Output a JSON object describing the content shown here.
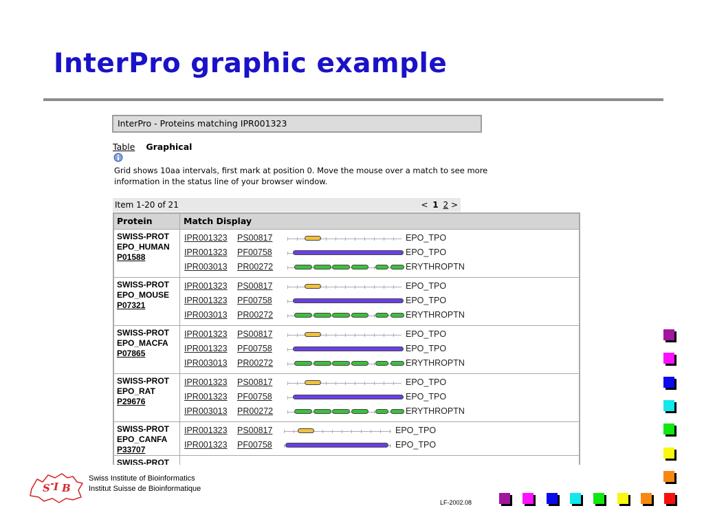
{
  "slide": {
    "title": "InterPro graphic example"
  },
  "page": {
    "header": "InterPro - Proteins matching IPR001323",
    "tabs": {
      "table": "Table",
      "graphical": "Graphical"
    },
    "help_text": "Grid shows 10aa intervals, first mark at position 0. Move the mouse over a match to see more information in the status line of your browser window.",
    "item_count": "Item 1-20 of 21",
    "pager": {
      "prev": "<",
      "current": "1",
      "next_page": "2",
      "next": ">"
    },
    "columns": {
      "protein": "Protein",
      "match_display": "Match Display"
    }
  },
  "colors": {
    "title": "#1a12c8",
    "prosite_match": "#f0c040",
    "pfam_match": "#6a3fe8",
    "prints_match": "#3dbf3d"
  },
  "proteins": [
    {
      "db": "SWISS-PROT",
      "name": "EPO_HUMAN",
      "accession": "P01588",
      "matches": [
        {
          "ipr": "IPR001323",
          "sig": "PS00817",
          "label": "EPO_TPO",
          "type": "prosite"
        },
        {
          "ipr": "IPR001323",
          "sig": "PF00758",
          "label": "EPO_TPO",
          "type": "pfam"
        },
        {
          "ipr": "IPR003013",
          "sig": "PR00272",
          "label": "ERYTHROPTN",
          "type": "prints"
        }
      ]
    },
    {
      "db": "SWISS-PROT",
      "name": "EPO_MOUSE",
      "accession": "P07321",
      "matches": [
        {
          "ipr": "IPR001323",
          "sig": "PS00817",
          "label": "EPO_TPO",
          "type": "prosite"
        },
        {
          "ipr": "IPR001323",
          "sig": "PF00758",
          "label": "EPO_TPO",
          "type": "pfam"
        },
        {
          "ipr": "IPR003013",
          "sig": "PR00272",
          "label": "ERYTHROPTN",
          "type": "prints"
        }
      ]
    },
    {
      "db": "SWISS-PROT",
      "name": "EPO_MACFA",
      "accession": "P07865",
      "matches": [
        {
          "ipr": "IPR001323",
          "sig": "PS00817",
          "label": "EPO_TPO",
          "type": "prosite"
        },
        {
          "ipr": "IPR001323",
          "sig": "PF00758",
          "label": "EPO_TPO",
          "type": "pfam"
        },
        {
          "ipr": "IPR003013",
          "sig": "PR00272",
          "label": "ERYTHROPTN",
          "type": "prints"
        }
      ]
    },
    {
      "db": "SWISS-PROT",
      "name": "EPO_RAT",
      "accession": "P29676",
      "matches": [
        {
          "ipr": "IPR001323",
          "sig": "PS00817",
          "label": "EPO_TPO",
          "type": "prosite"
        },
        {
          "ipr": "IPR001323",
          "sig": "PF00758",
          "label": "EPO_TPO",
          "type": "pfam"
        },
        {
          "ipr": "IPR003013",
          "sig": "PR00272",
          "label": "ERYTHROPTN",
          "type": "prints"
        }
      ]
    },
    {
      "db": "SWISS-PROT",
      "name": "EPO_CANFA",
      "accession": "P33707",
      "matches": [
        {
          "ipr": "IPR001323",
          "sig": "PS00817",
          "label": "EPO_TPO",
          "type": "prosite"
        },
        {
          "ipr": "IPR001323",
          "sig": "PF00758",
          "label": "EPO_TPO",
          "type": "pfam"
        }
      ]
    },
    {
      "db": "SWISS-PROT",
      "name": "",
      "accession": "",
      "matches": []
    }
  ],
  "footer": {
    "logo_text": "SIB",
    "org_en": "Swiss Institute of Bioinformatics",
    "org_fr": "Institut Suisse de Bioinformatique",
    "doc_id": "LF-2002.08"
  },
  "decor": {
    "side_colors": [
      "#a0169e",
      "#ff10ff",
      "#0a0aee",
      "#10e8ec",
      "#10e810",
      "#f8f810",
      "#f88810"
    ],
    "bottom_colors": [
      "#a0169e",
      "#ff10ff",
      "#0a0aee",
      "#10e8ec",
      "#10e810",
      "#f8f810",
      "#f88810",
      "#f81010"
    ]
  }
}
